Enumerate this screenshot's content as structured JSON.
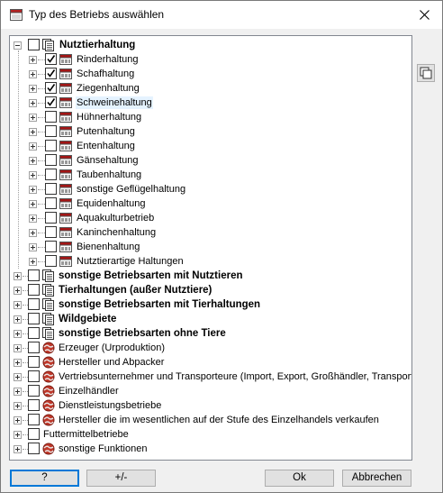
{
  "window": {
    "title": "Typ des Betriebs auswählen"
  },
  "tree": {
    "root": {
      "label": "Nutztierhaltung",
      "expanded": true
    },
    "children": [
      {
        "label": "Rinderhaltung",
        "checked": true
      },
      {
        "label": "Schafhaltung",
        "checked": true
      },
      {
        "label": "Ziegenhaltung",
        "checked": true
      },
      {
        "label": "Schweinehaltung",
        "checked": true,
        "selected": true
      },
      {
        "label": "Hühnerhaltung",
        "checked": false
      },
      {
        "label": "Putenhaltung",
        "checked": false
      },
      {
        "label": "Entenhaltung",
        "checked": false
      },
      {
        "label": "Gänsehaltung",
        "checked": false
      },
      {
        "label": "Taubenhaltung",
        "checked": false
      },
      {
        "label": "sonstige Geflügelhaltung",
        "checked": false
      },
      {
        "label": "Equidenhaltung",
        "checked": false
      },
      {
        "label": "Aquakulturbetrieb",
        "checked": false
      },
      {
        "label": "Kaninchenhaltung",
        "checked": false
      },
      {
        "label": "Bienenhaltung",
        "checked": false
      },
      {
        "label": "Nutztierartige Haltungen",
        "checked": false
      }
    ],
    "groups": [
      {
        "label": "sonstige Betriebsarten mit Nutztieren",
        "bold": true,
        "icon": "document-stack-icon"
      },
      {
        "label": "Tierhaltungen (außer Nutztiere)",
        "bold": true,
        "icon": "document-stack-icon"
      },
      {
        "label": "sonstige Betriebsarten mit Tierhaltungen",
        "bold": true,
        "icon": "document-stack-icon"
      },
      {
        "label": "Wildgebiete",
        "bold": true,
        "icon": "document-stack-icon"
      },
      {
        "label": "sonstige Betriebsarten ohne Tiere",
        "bold": true,
        "icon": "document-stack-icon"
      },
      {
        "label": "Erzeuger (Urproduktion)",
        "bold": false,
        "icon": "globe-icon"
      },
      {
        "label": "Hersteller und Abpacker",
        "bold": false,
        "icon": "globe-icon"
      },
      {
        "label": "Vertriebsunternehmer und Transporteure (Import, Export, Großhändler, Transport)",
        "bold": false,
        "icon": "globe-icon"
      },
      {
        "label": "Einzelhändler",
        "bold": false,
        "icon": "globe-icon"
      },
      {
        "label": "Dienstleistungsbetriebe",
        "bold": false,
        "icon": "globe-icon"
      },
      {
        "label": "Hersteller die im wesentlichen auf der Stufe des Einzelhandels verkaufen",
        "bold": false,
        "icon": "globe-icon"
      },
      {
        "label": "Futtermittelbetriebe",
        "bold": false,
        "icon": "none"
      },
      {
        "label": "sonstige Funktionen",
        "bold": false,
        "icon": "globe-icon"
      }
    ]
  },
  "buttons": {
    "help": "?",
    "toggle": "+/-",
    "ok": "Ok",
    "cancel": "Abbrechen"
  },
  "colors": {
    "accent": "#0078d7",
    "selection": "#e5f3ff",
    "icon_red": "#a31515"
  }
}
